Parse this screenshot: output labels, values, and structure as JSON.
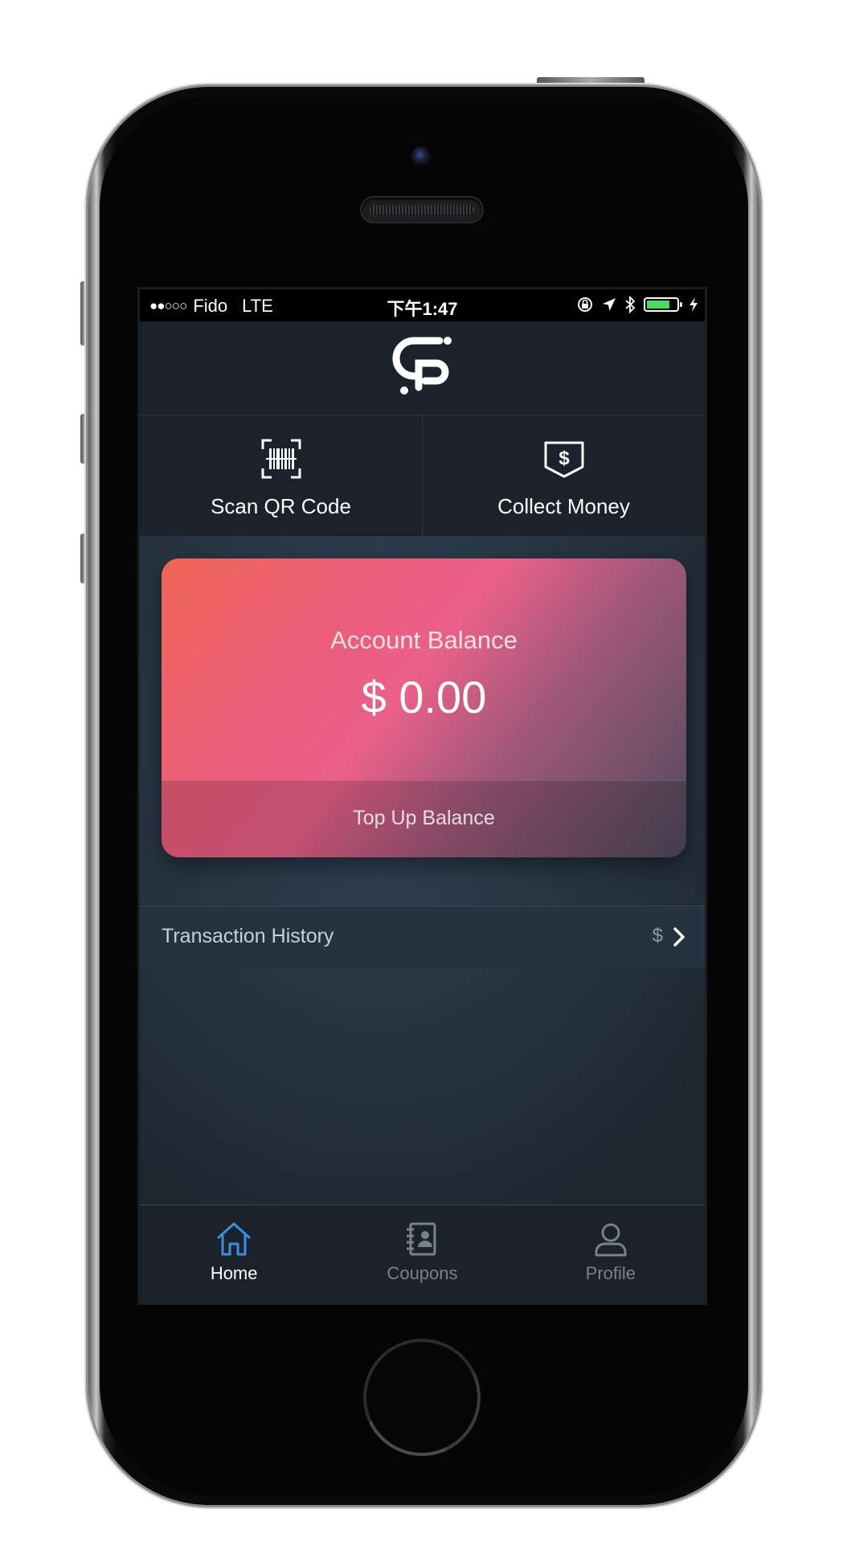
{
  "status_bar": {
    "signal": "●●○○○",
    "carrier": "Fido",
    "network": "LTE",
    "time": "下午1:47",
    "battery_level": 0.8,
    "icons": [
      "orientation-lock-icon",
      "location-arrow-icon",
      "bluetooth-icon",
      "battery-icon",
      "charging-bolt-icon"
    ]
  },
  "header": {
    "logo_icon": "app-logo-icon"
  },
  "actions": [
    {
      "label": "Scan QR Code",
      "icon": "barcode-scan-icon"
    },
    {
      "label": "Collect Money",
      "icon": "money-shield-icon"
    }
  ],
  "balance_card": {
    "title": "Account Balance",
    "amount": "$ 0.00",
    "top_up_label": "Top Up Balance"
  },
  "transaction_history": {
    "label": "Transaction History",
    "currency": "$",
    "icon": "chevron-right-icon"
  },
  "tab_bar": {
    "active": "Home",
    "tabs": [
      {
        "label": "Home",
        "icon": "home-icon"
      },
      {
        "label": "Coupons",
        "icon": "coupons-icon"
      },
      {
        "label": "Profile",
        "icon": "profile-icon"
      }
    ]
  },
  "colors": {
    "accent_active": "#3d8fe0",
    "card_gradient_start": "#ef6656",
    "card_gradient_mid": "#e9608a",
    "card_gradient_end": "#4e4a5c",
    "app_background": "#1b222b"
  }
}
